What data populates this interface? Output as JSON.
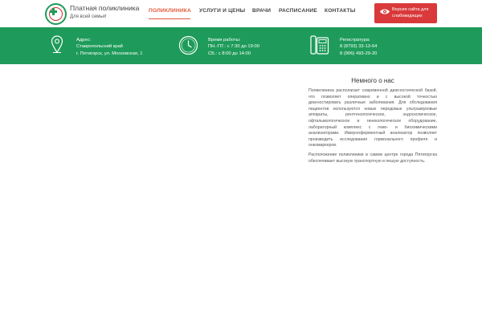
{
  "brand": {
    "title": "Платная поликлиника",
    "subtitle": "Для всей семьи!"
  },
  "nav": {
    "items": [
      {
        "label": "ПОЛИКЛИНИКА",
        "active": true
      },
      {
        "label": "УСЛУГИ И ЦЕНЫ",
        "active": false
      },
      {
        "label": "ВРАЧИ",
        "active": false
      },
      {
        "label": "РАСПИСАНИЕ",
        "active": false
      },
      {
        "label": "КОНТАКТЫ",
        "active": false
      }
    ]
  },
  "vision_button": {
    "label": "Версия сайта для слабовидящих",
    "icon": "eye-icon"
  },
  "info": {
    "address": {
      "icon": "location-pin-icon",
      "heading": "Адрес:",
      "line1": "Ставропольский край",
      "line2": "г. Пятигорск, ул. Московская, 1"
    },
    "hours": {
      "icon": "clock-icon",
      "heading": "Время работы:",
      "line1": "ПН.-ПТ.: с 7:30 до 19:00",
      "line2": "СБ.: с 8:00 до 14:00"
    },
    "registry": {
      "icon": "phone-icon",
      "heading": "Регистратура:",
      "line1": "8 (8793) 33-13-64",
      "line2": "8 (906) 493-29-20"
    }
  },
  "about": {
    "title": "Немного о нас",
    "paragraph1": "Поликлиника располагает современной диагностической базой, что позволяет оперативно и с высокой точностью диагностировать различные заболевания. Для обследования пациентов используются новые передовые ультразвуковые аппараты, рентгенологическое, эндоскопическое, офтальмологическое и гинекологическое оборудование, лабораторный комплекс с гемо- и биохимическими анализаторами. Иммуноферментный анализатор позволяет производить исследования гормонального профиля и онкомаркеров.",
    "paragraph2": "Расположение поликлиники в самом центре города Пятигорска обеспечивает высокую транспортную и пешую доступность."
  },
  "colors": {
    "brand_green": "#1e9b5a",
    "accent_red": "#d9393a",
    "nav_active": "#e05a3a"
  }
}
